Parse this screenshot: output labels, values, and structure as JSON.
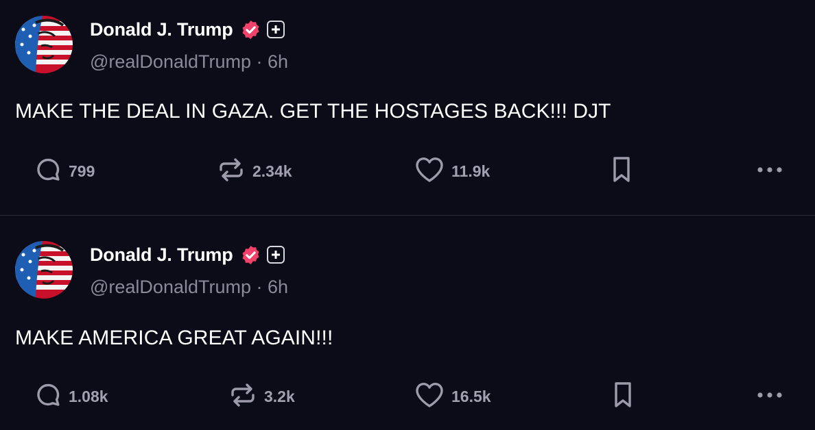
{
  "posts": [
    {
      "author": {
        "name": "Donald J. Trump",
        "handle": "@realDonaldTrump",
        "time": "6h"
      },
      "text": "MAKE THE DEAL IN GAZA. GET THE HOSTAGES BACK!!! DJT",
      "stats": {
        "replies": "799",
        "reposts": "2.34k",
        "likes": "11.9k"
      }
    },
    {
      "author": {
        "name": "Donald J. Trump",
        "handle": "@realDonaldTrump",
        "time": "6h"
      },
      "text": "MAKE AMERICA GREAT AGAIN!!!",
      "stats": {
        "replies": "1.08k",
        "reposts": "3.2k",
        "likes": "16.5k"
      }
    }
  ],
  "meta": {
    "separator": "·"
  },
  "colors": {
    "background": "#0c0b18",
    "verified": "#f2416b",
    "muted": "#8c8a99",
    "stat": "#a3a1b0",
    "icon": "#9e9cab"
  }
}
